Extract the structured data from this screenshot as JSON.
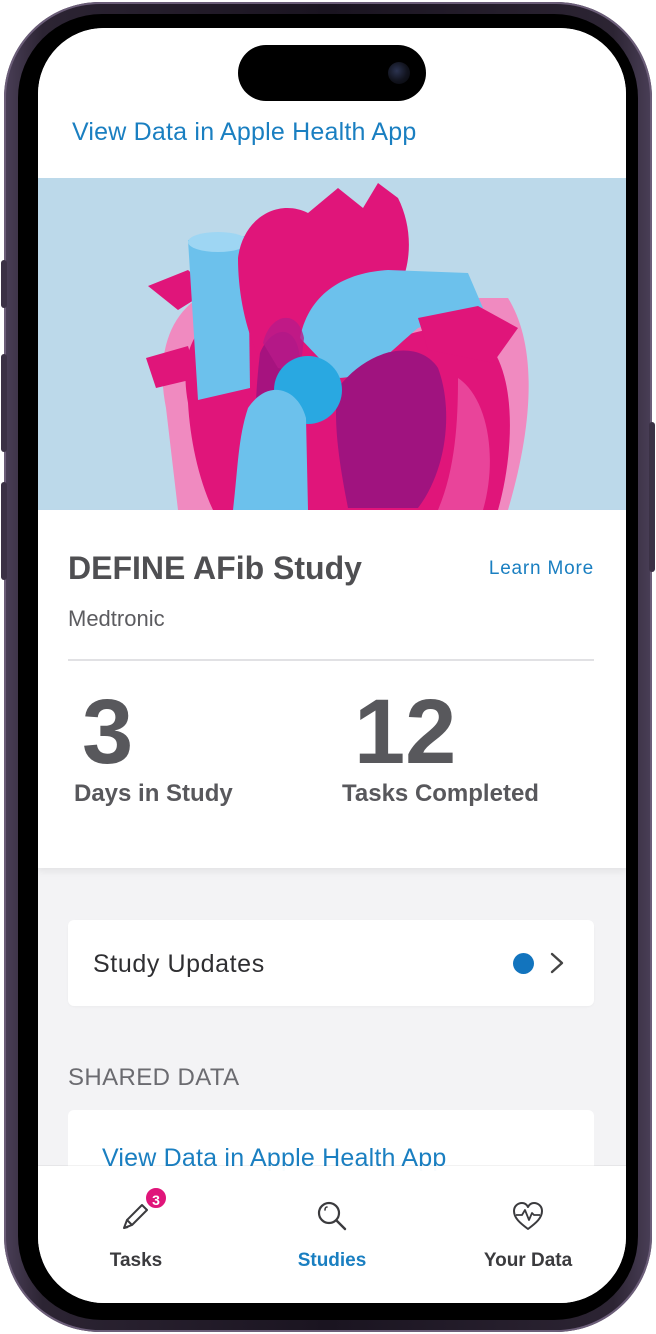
{
  "top_link": "View Data in Apple Health App",
  "study": {
    "title": "DEFINE AFib Study",
    "learn_more": "Learn More",
    "sponsor": "Medtronic",
    "stats": [
      {
        "value": "3",
        "label": "Days in Study"
      },
      {
        "value": "12",
        "label": "Tasks Completed"
      }
    ]
  },
  "updates": {
    "label": "Study Updates",
    "unread_indicator": true,
    "chevron_icon": "chevron-right-icon"
  },
  "shared_data": {
    "header": "SHARED DATA",
    "link": "View Data in Apple Health App"
  },
  "tabs": [
    {
      "label": "Tasks",
      "icon": "pencil-icon",
      "badge": "3",
      "active": false
    },
    {
      "label": "Studies",
      "icon": "search-icon",
      "active": true
    },
    {
      "label": "Your Data",
      "icon": "heart-pulse-icon",
      "active": false
    }
  ],
  "colors": {
    "accent": "#1a7fc1",
    "badge": "#e0157a",
    "hero_bg": "#bcd9ea",
    "heart_magenta": "#e0157a",
    "heart_blue": "#6cc1ec"
  }
}
